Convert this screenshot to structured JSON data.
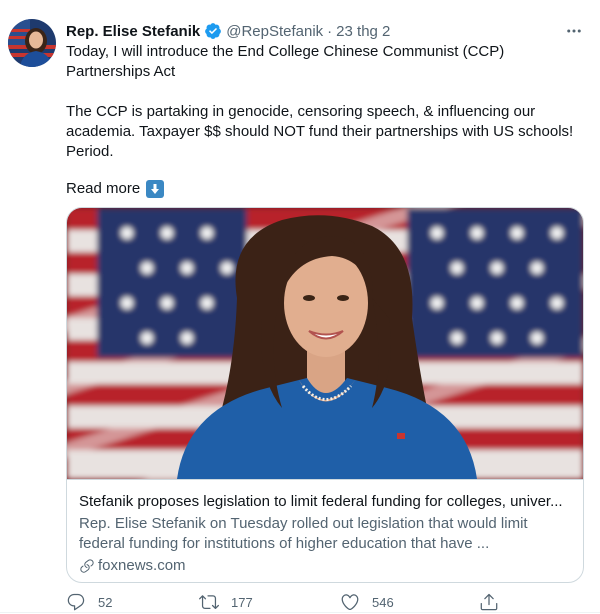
{
  "tweet": {
    "author_name": "Rep. Elise Stefanik",
    "handle": "@RepStefanik",
    "separator": "·",
    "timestamp": "23 thg 2",
    "paragraph_1": "Today, I will introduce the End College Chinese Communist (CCP) Partnerships Act",
    "paragraph_2": "The CCP is partaking in genocide, censoring speech, & influencing our academia. Taxpayer $$ should NOT fund their partnerships with US schools! Period.",
    "read_more": "Read more"
  },
  "card": {
    "title": "Stefanik proposes legislation to limit federal funding for colleges, univer...",
    "description": "Rep. Elise Stefanik on Tuesday rolled out legislation that would limit federal funding for institutions of higher education that have ...",
    "domain": "foxnews.com"
  },
  "actions": {
    "replies": "52",
    "retweets": "177",
    "likes": "546"
  },
  "colors": {
    "verified": "#1d9bf0",
    "secondary_text": "#536471",
    "border": "#cfd9de",
    "read_more_emoji_bg": "#3b88c3"
  },
  "icons": [
    "verified-badge-icon",
    "more-options-icon",
    "down-arrow-emoji-icon",
    "link-icon",
    "reply-icon",
    "retweet-icon",
    "like-icon",
    "share-icon"
  ]
}
